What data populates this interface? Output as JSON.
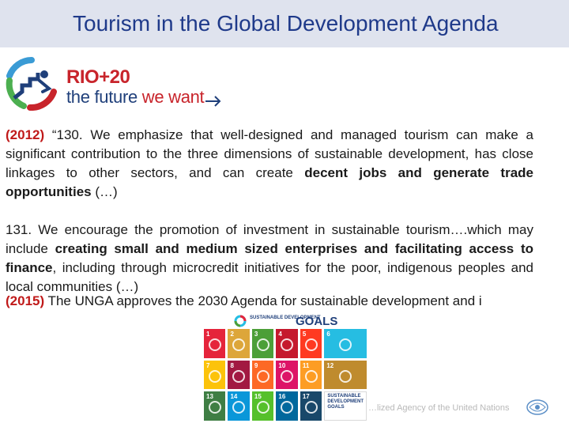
{
  "header": {
    "title": "Tourism in the Global Development Agenda"
  },
  "logo": {
    "name": "RIO+20",
    "tagline_part1": "the future",
    "tagline_part2": "we want"
  },
  "para1": {
    "year": "(2012)",
    "text": " “130. We emphasize that well-designed and managed tourism can make a significant contribution to the three dimensions of sustainable development, has close linkages to other sectors, and can create ",
    "bold": "decent jobs and generate trade opportunities",
    "end": " (…)"
  },
  "para2": {
    "t1": "131. We encourage the promotion of investment in sustainable tourism….which may include ",
    "b1": "creating small and medium sized enterprises and facilitating access to finance",
    "t2": ", including through microcredit initiatives for the poor, indigenous peoples and local communities (…)"
  },
  "para3": {
    "year": "(2015)",
    "text": " The UNGA approves the 2030 Agenda for sustainable development and i"
  },
  "sdg": {
    "head_word": "SUSTAINABLE DEVELOPMENT",
    "head_goals": "GOALS",
    "tiles": [
      {
        "n": "1",
        "color": "#e5243b"
      },
      {
        "n": "2",
        "color": "#dda63a"
      },
      {
        "n": "3",
        "color": "#4c9f38"
      },
      {
        "n": "4",
        "color": "#c5192d"
      },
      {
        "n": "5",
        "color": "#ff3a21"
      },
      {
        "n": "6",
        "color": "#26bde2"
      },
      {
        "n": "7",
        "color": "#fcc30b"
      },
      {
        "n": "8",
        "color": "#a21942"
      },
      {
        "n": "9",
        "color": "#fd6925"
      },
      {
        "n": "10",
        "color": "#dd1367"
      },
      {
        "n": "11",
        "color": "#fd9d24"
      },
      {
        "n": "12",
        "color": "#bf8b2e"
      },
      {
        "n": "13",
        "color": "#3f7e44"
      },
      {
        "n": "14",
        "color": "#0a97d9"
      },
      {
        "n": "15",
        "color": "#56c02b"
      },
      {
        "n": "16",
        "color": "#00689d"
      },
      {
        "n": "17",
        "color": "#19486a"
      }
    ],
    "final_tile": "SUSTAINABLE DEVELOPMENT GOALS"
  },
  "footer": {
    "text": "…lized Agency of the United Nations"
  }
}
